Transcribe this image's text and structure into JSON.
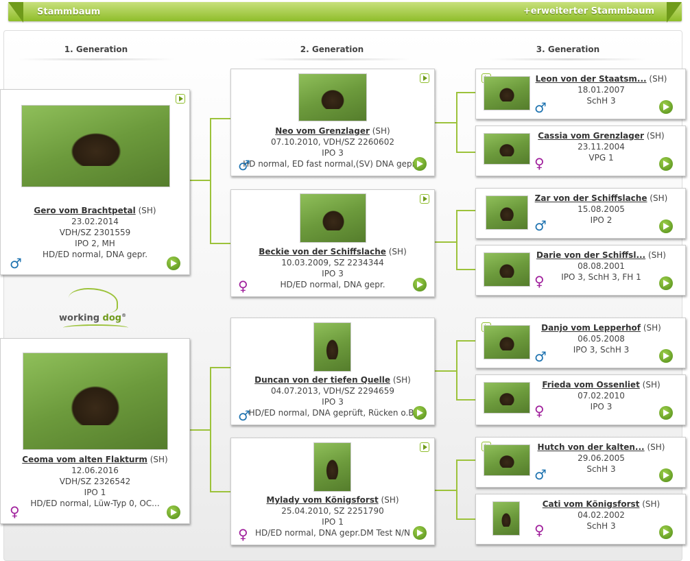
{
  "header": {
    "title": "Stammbaum",
    "extended_link": "+erweiterter Stammbaum"
  },
  "generations": [
    "1. Generation",
    "2. Generation",
    "3. Generation"
  ],
  "logo": {
    "text1": "working",
    "text2": "dog",
    "mark": "®"
  },
  "dogs": {
    "g1a": {
      "name": "Gero vom Brachtpetal",
      "breed": "(SH)",
      "lines": [
        "23.02.2014",
        "VDH/SZ 2301559",
        "IPO 2, MH",
        "HD/ED normal, DNA gepr."
      ],
      "sex_symbol": "♂"
    },
    "g1b": {
      "name": "Ceoma vom alten Flakturm",
      "breed": "(SH)",
      "lines": [
        "12.06.2016",
        "VDH/SZ 2326542",
        "IPO 1",
        "HD/ED normal, Lüw-Typ 0, OC..."
      ],
      "sex_symbol": "♀"
    },
    "g2a": {
      "name": "Neo vom Grenzlager",
      "breed": "(SH)",
      "lines": [
        "07.10.2010, VDH/SZ 2260602",
        "IPO 3",
        "HD normal, ED fast normal,(SV) DNA gepr..."
      ],
      "sex_symbol": "♂"
    },
    "g2b": {
      "name": "Beckie von der Schiffslache",
      "breed": "(SH)",
      "lines": [
        "10.03.2009, SZ 2234344",
        "IPO 3",
        "HD/ED normal, DNA gepr."
      ],
      "sex_symbol": "♀"
    },
    "g2c": {
      "name": "Duncan von der tiefen Quelle",
      "breed": "(SH)",
      "lines": [
        "04.07.2013, VDH/SZ 2294659",
        "IPO 3",
        "HD/ED normal, DNA geprüft, Rücken o.B."
      ],
      "sex_symbol": "♂"
    },
    "g2d": {
      "name": "Mylady vom Königsforst",
      "breed": "(SH)",
      "lines": [
        "25.04.2010, SZ 2251790",
        "IPO 1",
        "HD/ED normal, DNA gepr.DM Test N/N"
      ],
      "sex_symbol": "♀"
    },
    "g3a": {
      "name": "Leon von der Staatsm...",
      "breed": "(SH)",
      "lines": [
        "18.01.2007",
        "SchH 3"
      ],
      "sex_symbol": "♂"
    },
    "g3b": {
      "name": "Cassia vom Grenzlager",
      "breed": "(SH)",
      "lines": [
        "23.11.2004",
        "VPG 1"
      ],
      "sex_symbol": "♀"
    },
    "g3c": {
      "name": "Zar von der Schiffslache",
      "breed": "(SH)",
      "lines": [
        "15.08.2005",
        "IPO 2"
      ],
      "sex_symbol": "♂"
    },
    "g3d": {
      "name": "Darie von der Schiffsl...",
      "breed": "(SH)",
      "lines": [
        "08.08.2001",
        "IPO 3, SchH 3, FH 1"
      ],
      "sex_symbol": "♀"
    },
    "g3e": {
      "name": "Danjo vom Lepperhof",
      "breed": "(SH)",
      "lines": [
        "06.05.2008",
        "IPO 3, SchH 3"
      ],
      "sex_symbol": "♂"
    },
    "g3f": {
      "name": "Frieda vom Ossenliet",
      "breed": "(SH)",
      "lines": [
        "07.02.2010",
        "IPO 3"
      ],
      "sex_symbol": "♀"
    },
    "g3g": {
      "name": "Hutch von der kalten...",
      "breed": "(SH)",
      "lines": [
        "29.06.2005",
        "SchH 3"
      ],
      "sex_symbol": "♂"
    },
    "g3h": {
      "name": "Cati vom Königsforst",
      "breed": "(SH)",
      "lines": [
        "04.02.2002",
        "SchH 3"
      ],
      "sex_symbol": "♀"
    }
  }
}
